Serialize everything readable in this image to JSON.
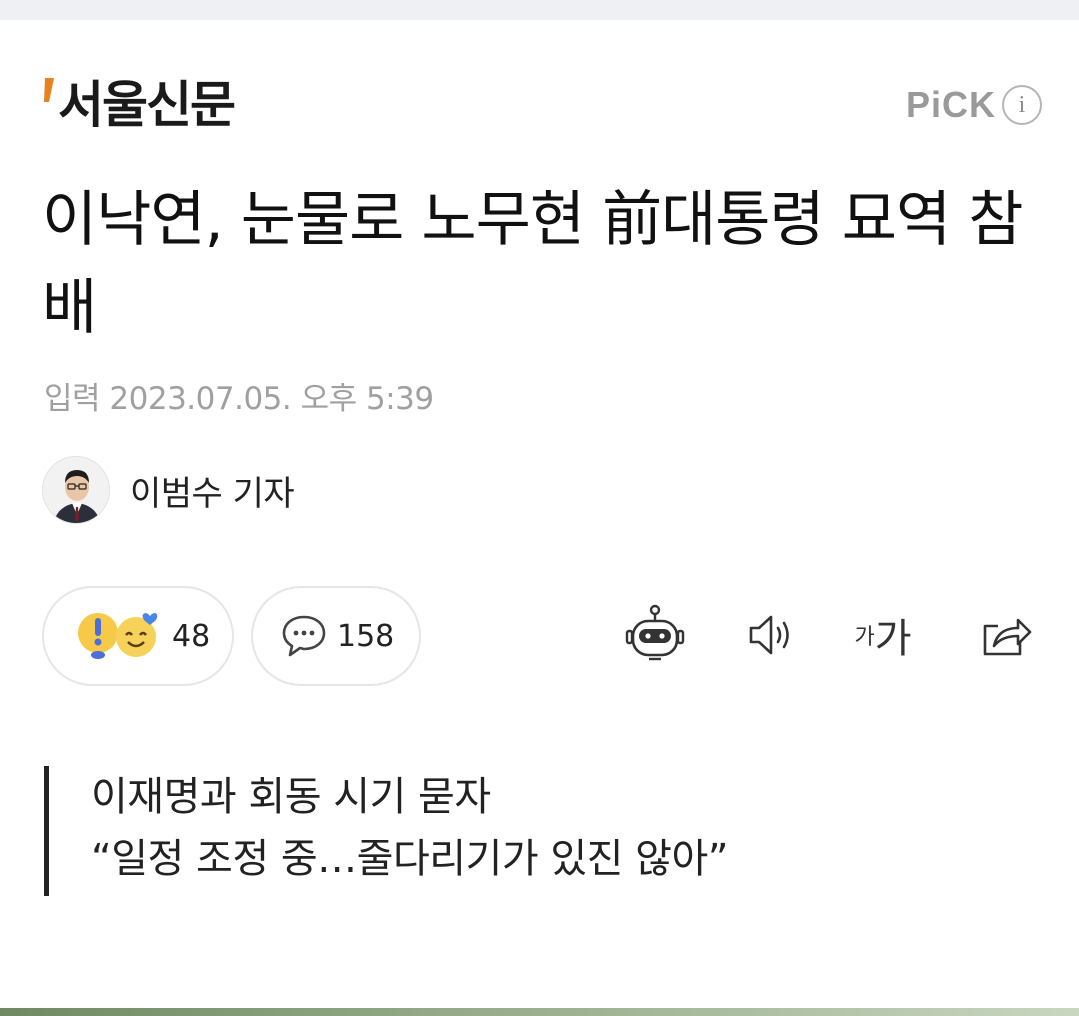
{
  "publisher": {
    "name": "서울신문",
    "brand_color": "#e8821e",
    "pick_label": "PiCK",
    "info_icon_text": "i"
  },
  "article": {
    "headline": "이낙연, 눈물로 노무현 前대통령 묘역 참배",
    "dateline": "입력 2023.07.05. 오후 5:39",
    "author": "이범수 기자",
    "author_avatar_icon": "reporter-avatar-icon",
    "summary": [
      "이재명과 회동 시기 묻자",
      "“일정 조정 중…줄다리기가 있진 않아”"
    ]
  },
  "engagement": {
    "reactions_count": "48",
    "comments_count": "158",
    "reaction_icons": [
      "surprised-emoji-icon",
      "heart-smile-emoji-icon"
    ],
    "comment_icon": "speech-bubble-icon"
  },
  "toolbar": {
    "bot_icon": "robot-summary-icon",
    "audio_icon": "speaker-icon",
    "font_small": "가",
    "font_large": "가",
    "share_icon": "share-icon"
  }
}
